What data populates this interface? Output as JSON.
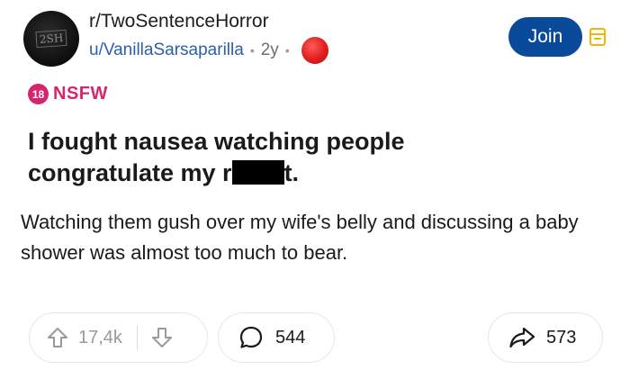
{
  "post": {
    "subreddit": "r/TwoSentenceHorror",
    "avatar_text": "2SH",
    "author": "u/VanillaSarsaparilla",
    "separator": "•",
    "age": "2y",
    "join_label": "Join",
    "nsfw_badge": "18",
    "nsfw_label": "NSFW",
    "title_line1": "I fought nausea watching people",
    "title_line2_before": "congratulate my r",
    "title_line2_after": "t.",
    "body": "Watching them gush over my wife's belly and discussing a baby shower was almost too much to bear."
  },
  "actions": {
    "score": "17,4k",
    "comments": "544",
    "shares": "573"
  },
  "colors": {
    "join_bg": "#0a4a9a",
    "nsfw": "#d6246e",
    "username": "#2b5fa8",
    "bell": "#f2b705",
    "red_dot": "#e11d1d"
  },
  "icons": [
    "upvote-icon",
    "downvote-icon",
    "comment-icon",
    "share-icon",
    "bell-icon"
  ]
}
